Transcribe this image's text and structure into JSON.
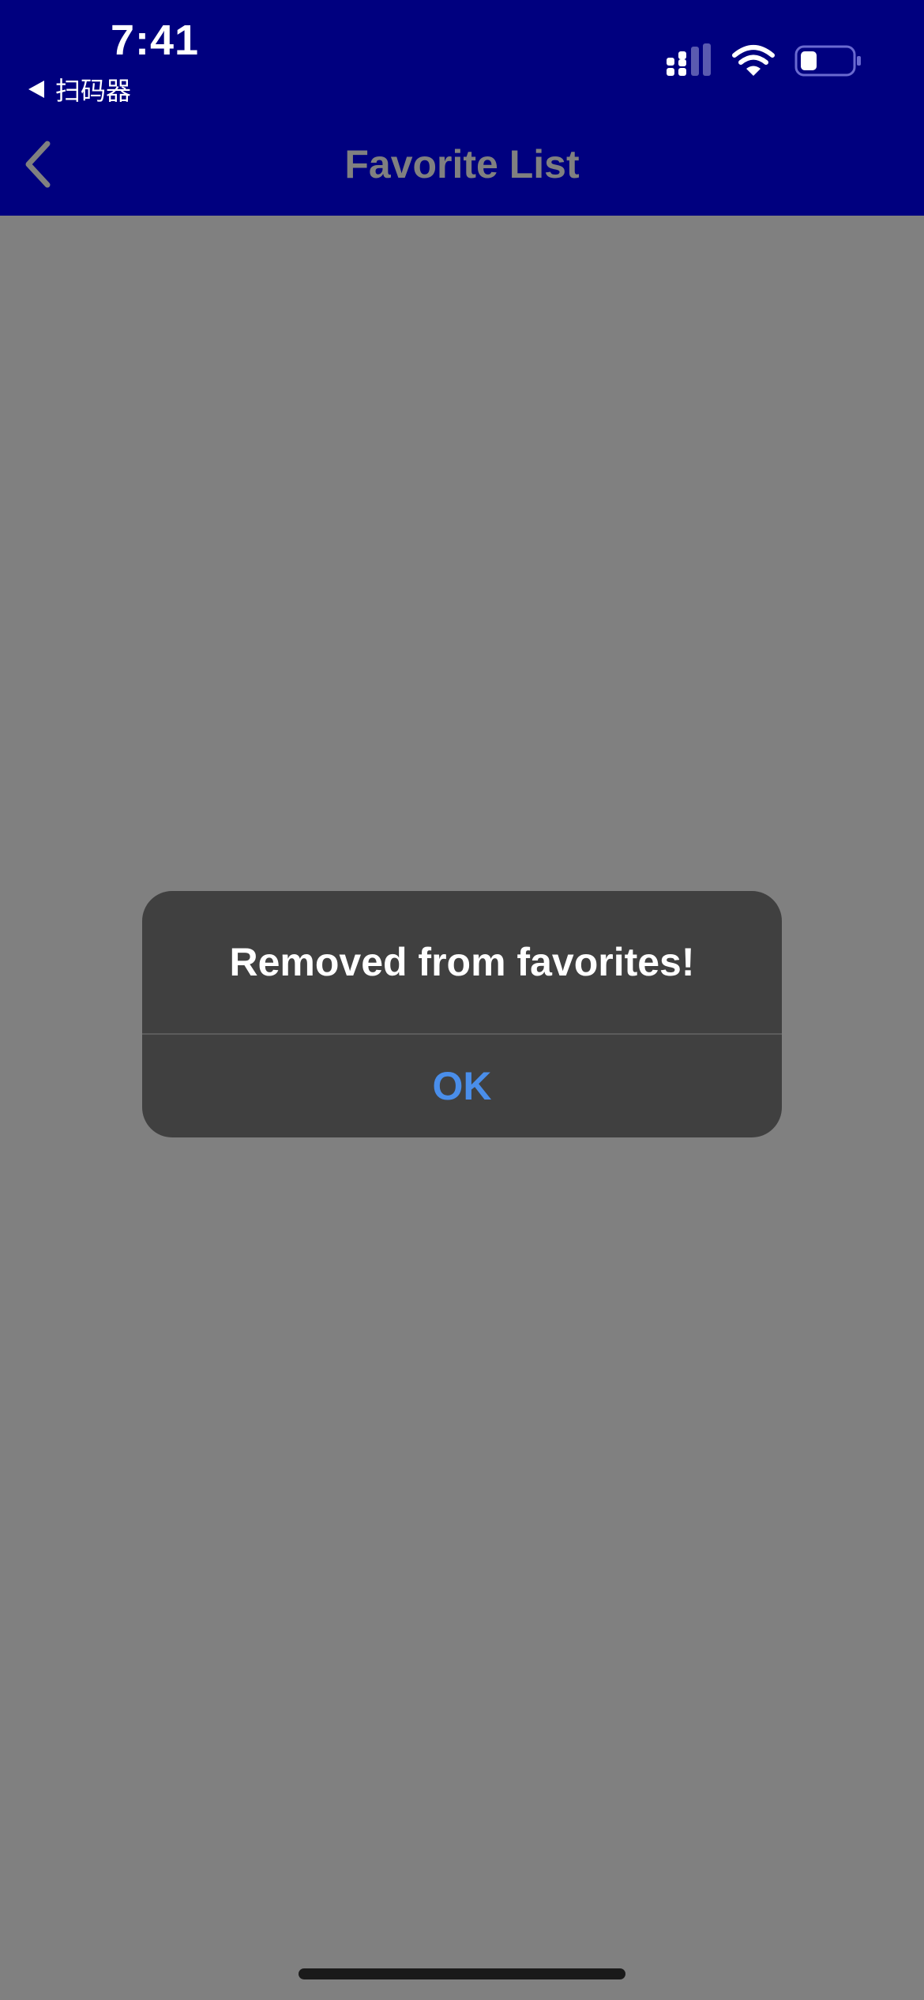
{
  "status_bar": {
    "time": "7:41",
    "back_app_label": "扫码器",
    "icons": [
      "cellular-signal-icon",
      "wifi-icon",
      "battery-icon"
    ]
  },
  "nav": {
    "title": "Favorite List",
    "back_icon": "chevron-left-icon"
  },
  "alert": {
    "message": "Removed from favorites!",
    "ok_label": "OK"
  },
  "colors": {
    "header_bg": "#00007f",
    "content_bg": "#808080",
    "alert_bg": "#404040",
    "alert_button": "#4a8eea",
    "title": "#808080"
  }
}
